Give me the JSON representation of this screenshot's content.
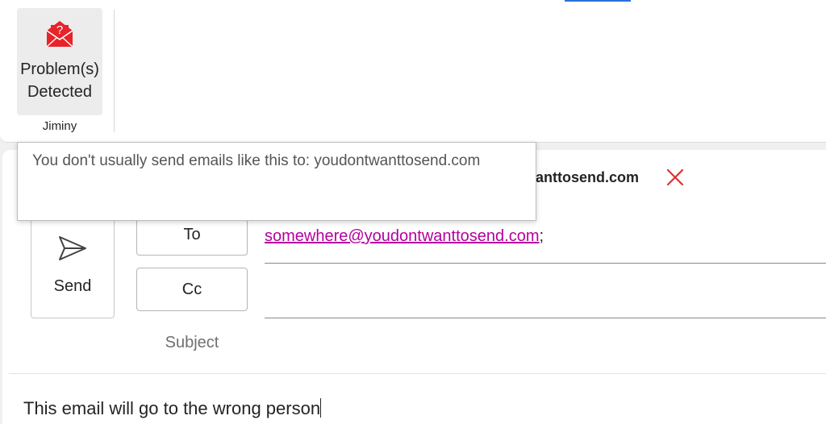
{
  "ribbon": {
    "jiminy_button": {
      "label": "Problem(s)\nDetected",
      "icon": "envelope-question-icon",
      "icon_color": "#e8232a"
    },
    "group_label": "Jiminy"
  },
  "compose": {
    "warning": {
      "visible_text": "ntwanttosend.com",
      "remove_icon": "close-x-icon",
      "remove_color": "#e03030"
    },
    "send": {
      "label": "Send",
      "icon": "send-paper-plane-icon"
    },
    "to": {
      "label": "To",
      "recipients": [
        "somewhere@youdontwanttosend.com"
      ],
      "separator": ";",
      "link_color": "#b4009e"
    },
    "cc": {
      "label": "Cc",
      "value": ""
    },
    "subject": {
      "label": "Subject",
      "value": ""
    },
    "body": {
      "text": "This email will go to the wrong person"
    }
  },
  "tooltip": {
    "text": "You don't usually send emails like this to: youdontwanttosend.com"
  }
}
